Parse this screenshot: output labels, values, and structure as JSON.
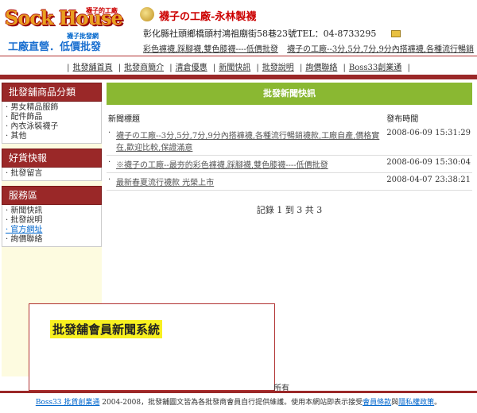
{
  "header": {
    "logo_word": "Sock House",
    "logo_chinese": "襪子的工廠",
    "logo_small": "襪子批發網",
    "logo_slogan": "工廠直營．低價批發",
    "company_name": "襪子の工廠-永林製襪",
    "company_address": "彰化縣社頭鄉橋頭村鴻祖廟街58巷23號TEL：04-8733295",
    "marquee": [
      "彩色褲襪,踩腳襪,雙色膝襪----低價批發",
      "襪子の工廠--3分,5分,7分,9分內搭褲襪,各種流行暢銷"
    ]
  },
  "nav": [
    "批發舖首頁",
    "批發商簡介",
    "清倉優惠",
    "新聞快訊",
    "批發說明",
    "詢價聯絡",
    "Boss33創業通"
  ],
  "sidebar": {
    "sections": [
      {
        "title": "批發舖商品分類",
        "items": [
          "男女精品服飾",
          "配件飾品",
          "內衣泳裝襪子",
          "其他"
        ]
      },
      {
        "title": "好貨快報",
        "items": [
          "批發留言"
        ]
      },
      {
        "title": "服務區",
        "items": [
          "新聞快訊",
          "批發說明",
          "官方網址",
          "詢價聯絡"
        ]
      }
    ]
  },
  "main": {
    "title": "批發新聞快訊",
    "col_title": "新聞標題",
    "col_date": "發布時間",
    "rows": [
      {
        "bullet": "·",
        "title": "襪子の工廠--3分,5分,7分,9分內搭褲襪,各種流行暢銷襪款,工廠自產,價格實在,歡迎比較,保證滿意",
        "date": "2008-06-09 15:31:29"
      },
      {
        "bullet": "·",
        "title": "※襪子の工廠--最夯的彩色褲襪,踩腳襪,雙色膝襪----低價批發",
        "date": "2008-06-09 15:30:04"
      },
      {
        "bullet": "·",
        "title": "最新春夏流行襪款 光榮上市",
        "date": "2008-04-07 23:38:21"
      }
    ],
    "pager": "記錄 1 到 3 共 3"
  },
  "popup": {
    "title": "批發舖會員新聞系統"
  },
  "footer": {
    "rights": "所有",
    "boss": "Boss33 批貨創業通",
    "copy_mid": " 2004-2008，批發舖圖文皆為各批發商會員自行提供維護。使用本網站即表示接受",
    "member_terms": "會員條款",
    "and": "與",
    "privacy": "隱私權政策",
    "end": "。"
  }
}
